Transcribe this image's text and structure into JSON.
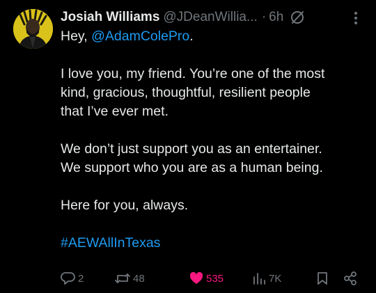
{
  "tweet": {
    "author": {
      "display_name": "Josiah Williams",
      "handle": "@JDeanWillia...",
      "time_separator": "·",
      "time": "6h"
    },
    "body": {
      "greeting_prefix": "Hey, ",
      "mention": "@AdamColePro",
      "greeting_suffix": ".",
      "para1_line1": "I love you, my friend. You’re one of the most",
      "para1_line2": "kind, gracious, thoughtful, resilient people",
      "para1_line3": "that I’ve ever met.",
      "para2_line1": "We don’t just support you as an entertainer.",
      "para2_line2": "We support who you are as a human being.",
      "para3": "Here for you, always.",
      "hashtag": "#AEWAllInTexas"
    },
    "actions": {
      "replies": "2",
      "reposts": "48",
      "likes": "535",
      "views": "7K"
    },
    "icons": {
      "edit": "edited-icon",
      "more": "more-options-icon",
      "reply": "reply-icon",
      "repost": "repost-icon",
      "like": "heart-icon",
      "views": "views-icon",
      "bookmark": "bookmark-icon",
      "share": "share-icon"
    },
    "colors": {
      "background": "#000000",
      "text": "#e7e9ea",
      "muted": "#71767b",
      "link": "#1d9bf0",
      "like": "#f91880",
      "avatar_bg": "#d9c21a"
    }
  }
}
